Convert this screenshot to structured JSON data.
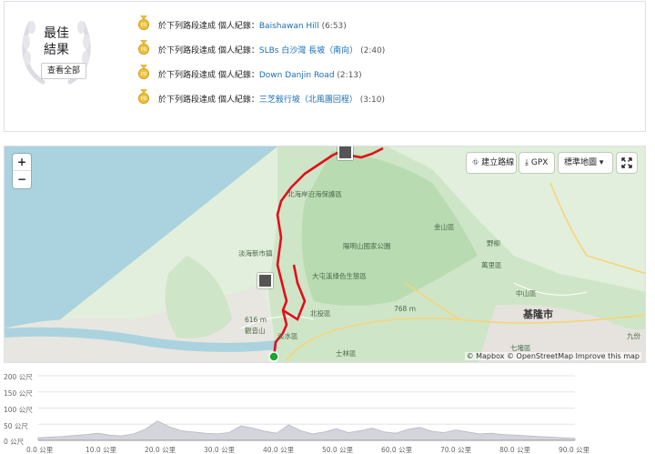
{
  "best_efforts": {
    "title_line1": "最佳",
    "title_line2": "結果",
    "view_all": "查看全部",
    "items": [
      {
        "prefix": "於下列路段達成 個人紀錄：",
        "segment": "Baishawan Hill",
        "time": "(6:53)"
      },
      {
        "prefix": "於下列路段達成 個人紀錄：",
        "segment": "SLBs 白沙灣 長坡（南向）",
        "time": "(2:40)"
      },
      {
        "prefix": "於下列路段達成 個人紀錄：",
        "segment": "Down Danjin Road",
        "time": "(2:13)"
      },
      {
        "prefix": "於下列路段達成 個人紀錄：",
        "segment": "三芝敍行坡（北風團回程）",
        "time": "(3:10)"
      }
    ]
  },
  "map": {
    "zoom_in": "+",
    "zoom_out": "−",
    "create_route": "建立路線",
    "gpx": "GPX",
    "map_style": "標準地圖",
    "attribution": "© Mapbox © OpenStreetMap Improve this map",
    "places": [
      {
        "name": "北海岸沿海保護區"
      },
      {
        "name": "金山區"
      },
      {
        "name": "野柳"
      },
      {
        "name": "萬里區"
      },
      {
        "name": "淡海新市鎮"
      },
      {
        "name": "陽明山國家公園"
      },
      {
        "name": "大屯溪綠色生態區"
      },
      {
        "name": "淡水區"
      },
      {
        "name": "北投區"
      },
      {
        "name": "768 m"
      },
      {
        "name": "616 m"
      },
      {
        "name": "觀音山"
      },
      {
        "name": "中山區"
      },
      {
        "name": "基隆市"
      },
      {
        "name": "九份"
      },
      {
        "name": "士林區"
      },
      {
        "name": "七堵區"
      }
    ]
  },
  "elevation": {
    "y_labels": [
      "200 公尺",
      "150 公尺",
      "100 公尺",
      "50 公尺",
      "0 公尺"
    ],
    "x_labels": [
      "0.0 公里",
      "10.0 公里",
      "20.0 公里",
      "30.0 公里",
      "40.0 公里",
      "50.0 公里",
      "60.0 公里",
      "70.0 公里",
      "80.0 公里",
      "90.0 公里"
    ],
    "profile_km": [
      0,
      2,
      4,
      6,
      8,
      10,
      12,
      14,
      16,
      18,
      20,
      22,
      24,
      26,
      28,
      30,
      32,
      34,
      36,
      38,
      40,
      42,
      44,
      46,
      48,
      50,
      52,
      54,
      56,
      58,
      60,
      62,
      64,
      66,
      68,
      70,
      72,
      74,
      76,
      78,
      80,
      82,
      84,
      86,
      88,
      90
    ],
    "profile_m": [
      8,
      10,
      12,
      15,
      18,
      22,
      16,
      14,
      20,
      35,
      60,
      42,
      30,
      26,
      22,
      20,
      24,
      45,
      38,
      28,
      22,
      48,
      30,
      20,
      26,
      36,
      24,
      30,
      38,
      26,
      22,
      34,
      40,
      28,
      24,
      32,
      26,
      20,
      22,
      18,
      16,
      14,
      12,
      10,
      8,
      6
    ]
  }
}
